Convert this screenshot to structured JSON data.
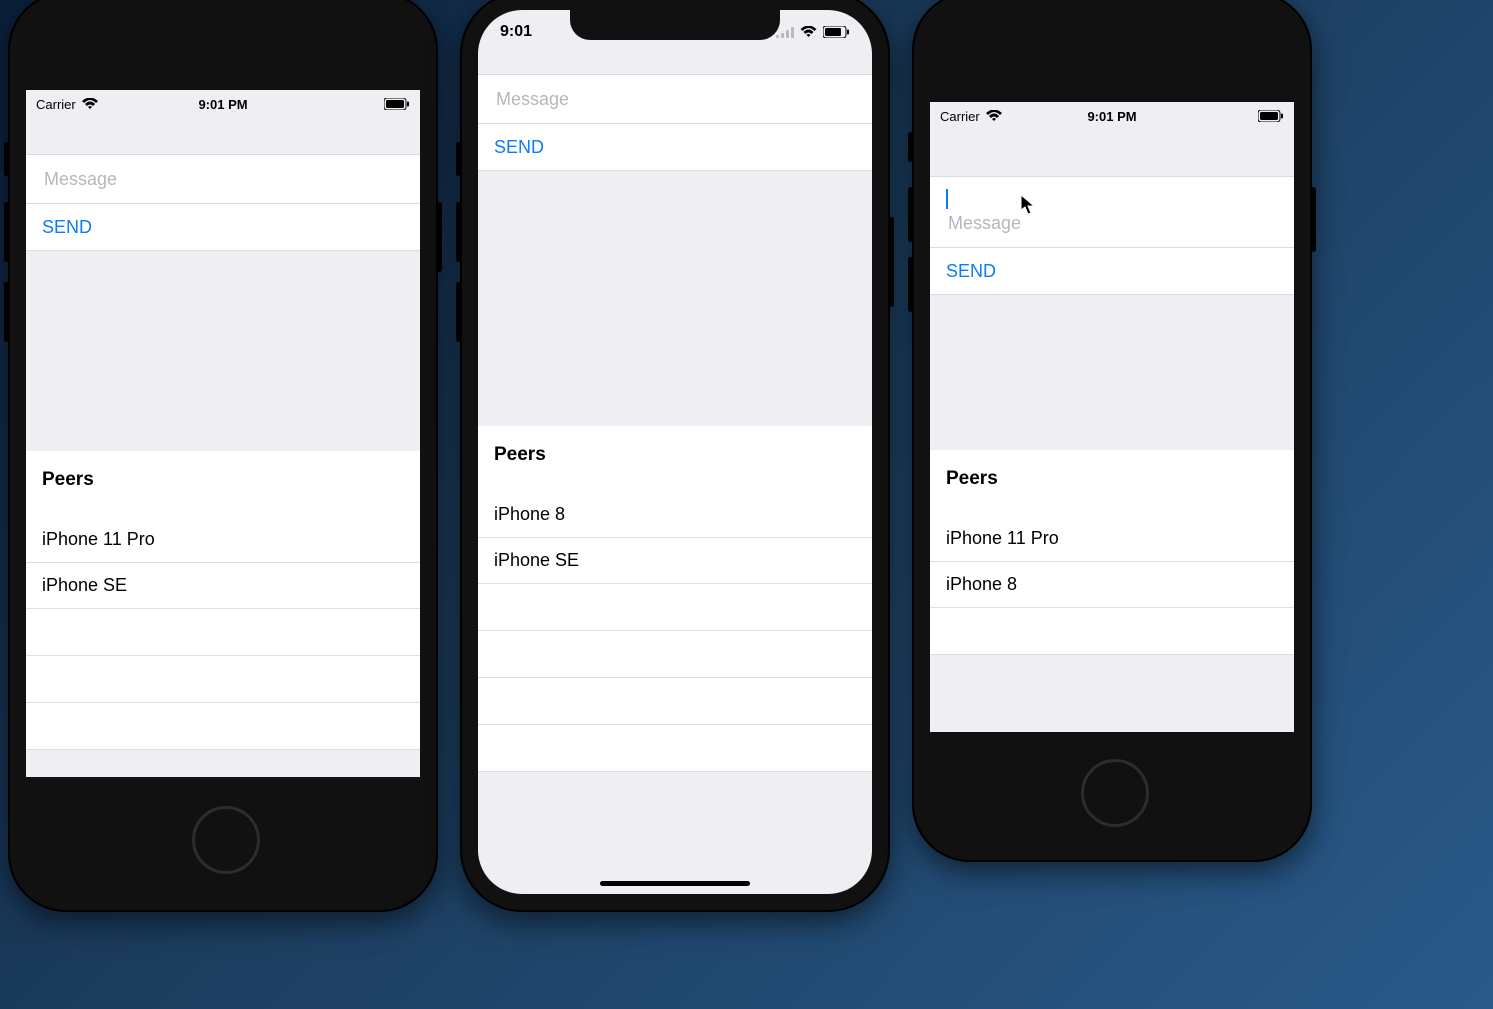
{
  "devices": [
    {
      "id": "phone-left",
      "status_bar": {
        "carrier": "Carrier",
        "time": "9:01 PM"
      },
      "message_placeholder": "Message",
      "send_label": "SEND",
      "peers_title": "Peers",
      "peers": [
        "iPhone 11 Pro",
        "iPhone SE"
      ]
    },
    {
      "id": "phone-center",
      "status_bar": {
        "time": "9:01"
      },
      "message_placeholder": "Message",
      "send_label": "SEND",
      "peers_title": "Peers",
      "peers": [
        "iPhone 8",
        "iPhone SE"
      ]
    },
    {
      "id": "phone-right",
      "status_bar": {
        "carrier": "Carrier",
        "time": "9:01 PM"
      },
      "message_placeholder": "Message",
      "send_label": "SEND",
      "peers_title": "Peers",
      "peers": [
        "iPhone 11 Pro",
        "iPhone 8"
      ]
    }
  ],
  "colors": {
    "accent": "#0b7bff"
  }
}
